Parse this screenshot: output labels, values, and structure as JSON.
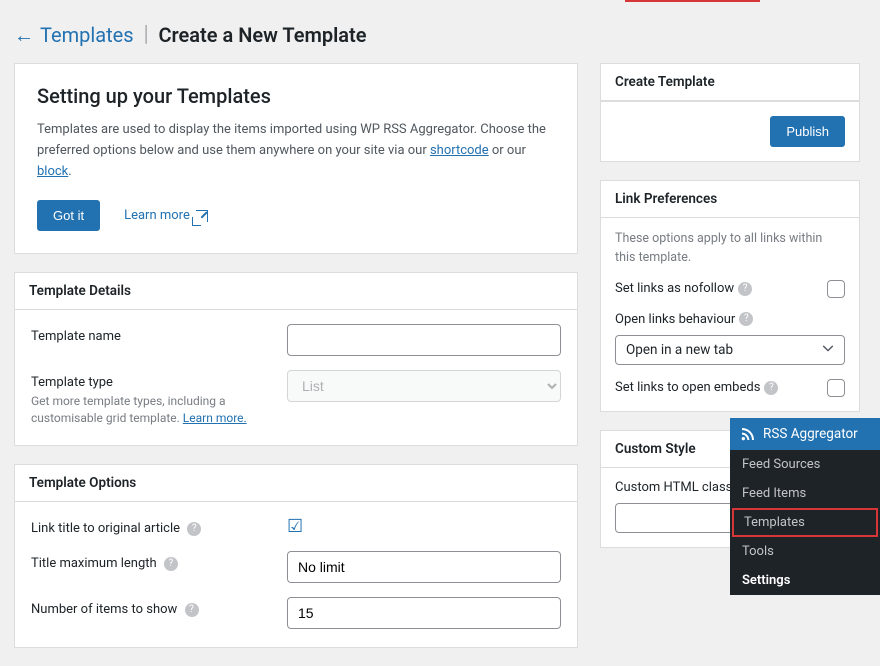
{
  "header": {
    "breadcrumb": "Templates",
    "title": "Create a New Template"
  },
  "intro": {
    "heading": "Setting up your Templates",
    "text_prefix": "Templates are used to display the items imported using WP RSS Aggregator. Choose the preferred options below and use them anywhere on your site via our ",
    "link1": "shortcode",
    "text_mid": " or our ",
    "link2": "block",
    "text_suffix": ".",
    "got_it": "Got it",
    "learn_more": "Learn more"
  },
  "template_details": {
    "title": "Template Details",
    "name_label": "Template name",
    "name_value": "",
    "type_label": "Template type",
    "type_value": "List",
    "type_hint_prefix": "Get more template types, including a customisable grid template. ",
    "type_hint_link": "Learn more."
  },
  "template_options": {
    "title": "Template Options",
    "link_title_label": "Link title to original article",
    "title_max_label": "Title maximum length",
    "title_max_value": "No limit",
    "num_items_label": "Number of items to show",
    "num_items_value": "15"
  },
  "create_panel": {
    "title": "Create Template",
    "publish": "Publish"
  },
  "link_prefs": {
    "title": "Link Preferences",
    "note": "These options apply to all links within this template.",
    "nofollow_label": "Set links as nofollow",
    "behavior_label": "Open links behaviour",
    "behavior_value": "Open in a new tab",
    "embeds_label": "Set links to open embeds"
  },
  "custom_style": {
    "title": "Custom Style",
    "class_label": "Custom HTML class"
  },
  "admin_menu": {
    "header": "RSS Aggregator",
    "items": [
      "Feed Sources",
      "Feed Items",
      "Templates",
      "Tools",
      "Settings"
    ]
  }
}
